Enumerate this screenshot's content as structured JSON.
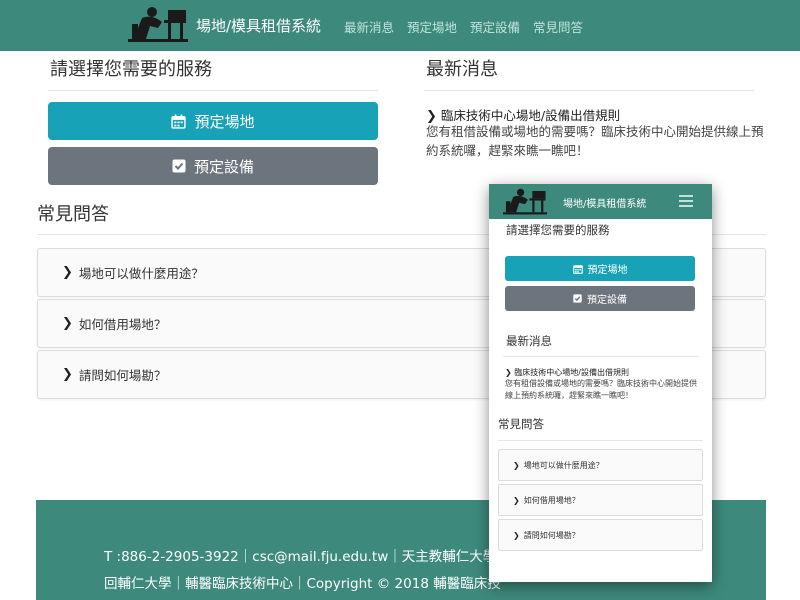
{
  "navbar": {
    "brand": "場地/模具租借系統",
    "links": [
      "最新消息",
      "預定場地",
      "預定設備",
      "常見問答"
    ]
  },
  "services": {
    "heading": "請選擇您需要的服務",
    "book_venue": "預定場地",
    "book_equipment": "預定設備"
  },
  "news": {
    "heading": "最新消息",
    "item_title": "臨床技術中心場地/設備出借規則",
    "item_body": "您有租借設備或場地的需要嗎？臨床技術中心開始提供線上預約系統囉，趕緊來瞧一瞧吧！"
  },
  "faq": {
    "heading": "常見問答",
    "items": [
      "場地可以做什麼用途？",
      "如何借用場地？",
      "請問如何場勘？"
    ]
  },
  "footer": {
    "line1": "T :886-2-2905-3922｜csc@mail.fju.edu.tw｜天主教輔仁大學｜",
    "line2": "回輔仁大學｜輔醫臨床技術中心｜Copyright © 2018 輔醫臨床技"
  },
  "mobile": {
    "brand": "場地/模具租借系統",
    "services_heading": "請選擇您需要的服務",
    "book_venue": "預定場地",
    "book_equipment": "預定設備",
    "news_heading": "最新消息",
    "news_title": "臨床技術中心場地/設備出借規則",
    "news_body": "您有租借設備或場地的需要嗎？臨床技術中心開始提供線上預約系統囉，趕緊來瞧一瞧吧！",
    "faq_heading": "常見問答",
    "faq_items": [
      "場地可以做什麼用途？",
      "如何借用場地？",
      "請問如何場勘？"
    ]
  },
  "icons": {
    "logo": "reading-person-logo",
    "calendar": "calendar-icon",
    "checkbox": "check-square-icon",
    "chevron": "chevron-right-icon",
    "menu": "hamburger-menu-icon"
  },
  "colors": {
    "brand_green": "#3d8a7c",
    "nav_link": "#bfe3da",
    "btn_teal": "#17a2b8",
    "btn_gray": "#6c757d"
  }
}
